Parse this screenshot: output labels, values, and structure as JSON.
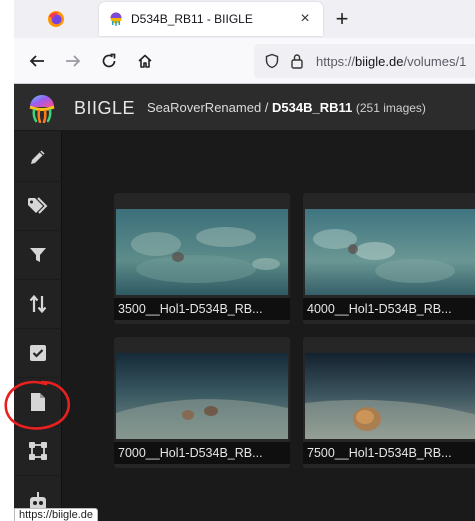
{
  "browser": {
    "tab_title": "D534B_RB11 - BIIGLE",
    "new_tab_label": "+",
    "close_label": "×",
    "url_prefix": "https://",
    "url_domain": "biigle.de",
    "url_path": "/volumes/1",
    "status_url": "https://biigle.de"
  },
  "app": {
    "brand": "BIIGLE",
    "project": "SeaRoverRenamed",
    "separator": " / ",
    "volume": "D534B_RB11",
    "image_count": "(251 images)"
  },
  "sidebar": {
    "items": [
      {
        "icon": "pencil-icon"
      },
      {
        "icon": "tags-icon"
      },
      {
        "icon": "filter-icon"
      },
      {
        "icon": "sort-icon"
      },
      {
        "icon": "check-square-icon"
      },
      {
        "icon": "file-icon"
      },
      {
        "icon": "vector-square-icon"
      },
      {
        "icon": "robot-icon"
      }
    ]
  },
  "images": [
    {
      "caption": "3500__Hol1-D534B_RB..."
    },
    {
      "caption": "4000__Hol1-D534B_RB..."
    },
    {
      "caption": "7000__Hol1-D534B_RB..."
    },
    {
      "caption": "7500__Hol1-D534B_RB..."
    }
  ],
  "colors": {
    "header_bg": "#2c2c2c",
    "sidebar_bg": "#222222",
    "main_bg": "#1a1a1a",
    "annotation_red": "#e8201f"
  }
}
